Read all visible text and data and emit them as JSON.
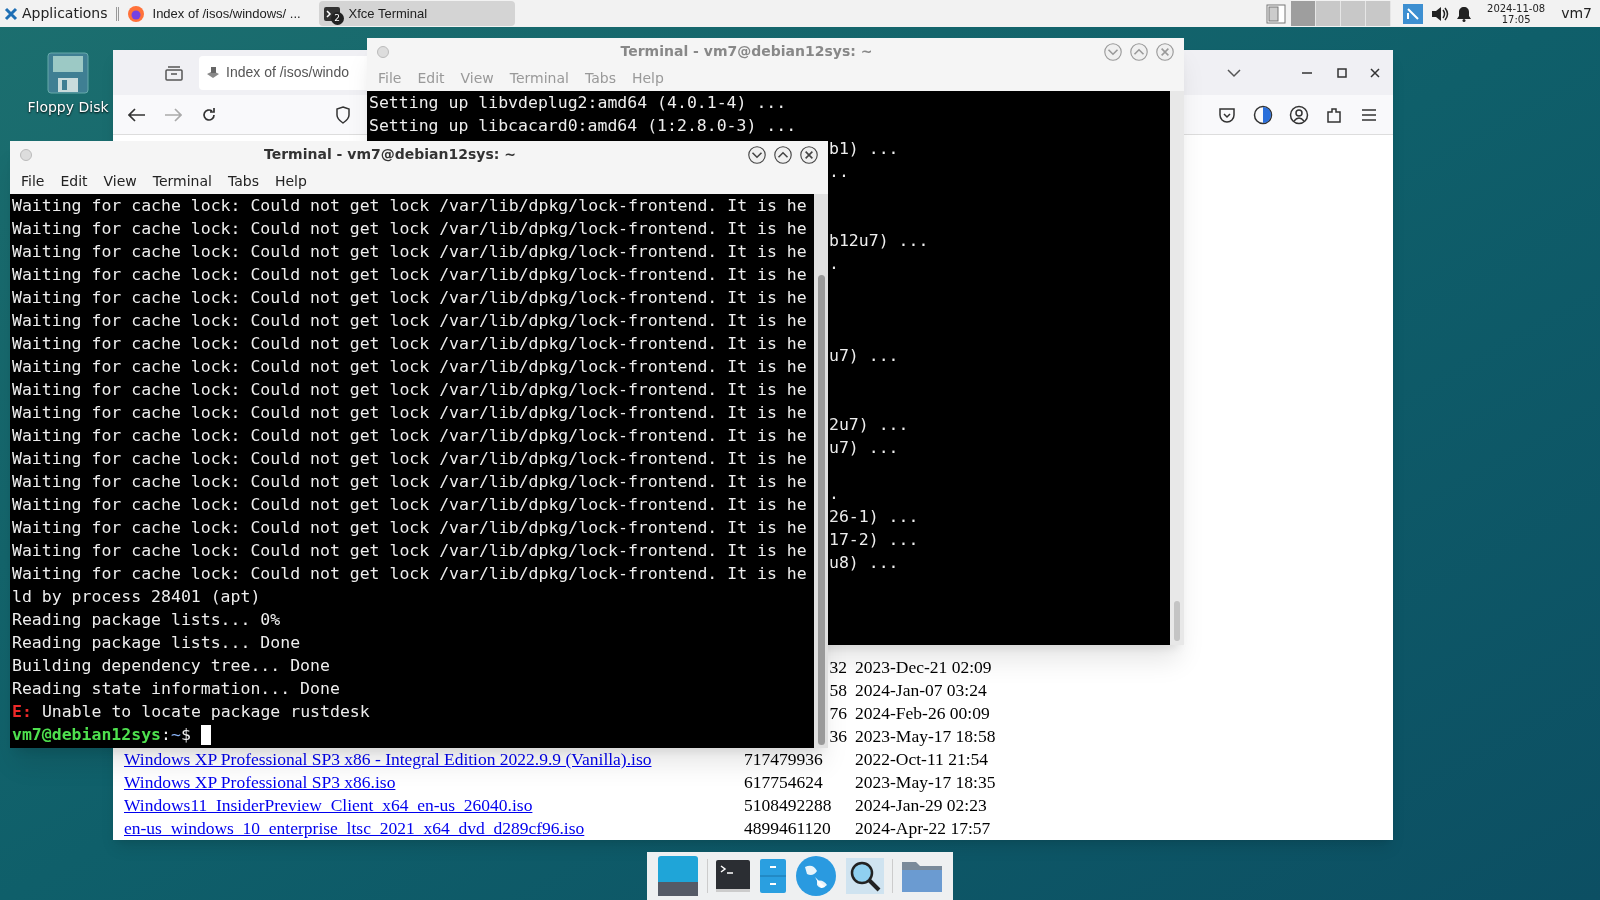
{
  "top_panel": {
    "menu_label": "Applications",
    "tasks": [
      {
        "kind": "browser",
        "label": "Index of /isos/windows/ ...",
        "selected": false
      },
      {
        "kind": "terminal",
        "label": "Xfce Terminal",
        "badge": "2",
        "selected": true
      }
    ],
    "workspaces": [
      {
        "selected": true
      },
      {
        "selected": false
      },
      {
        "selected": false
      },
      {
        "selected": false
      }
    ],
    "clock_date": "2024-11-08",
    "clock_time": "17:05",
    "user": "vm7"
  },
  "desktop_icons": [
    {
      "label": "Floppy Disk"
    }
  ],
  "browser": {
    "tab_title": "Index of /isos/windo",
    "rows": [
      {
        "kind": "partial",
        "size": "32",
        "date": "2023-Dec-21 02:09"
      },
      {
        "kind": "partial",
        "size": "58",
        "date": "2024-Jan-07 03:24"
      },
      {
        "kind": "partial",
        "size": "76",
        "date": "2024-Feb-26 00:09"
      },
      {
        "kind": "partial",
        "size": "36",
        "date": "2023-May-17 18:58"
      },
      {
        "kind": "full",
        "name": "Windows XP Professional SP3 x86 - Integral Edition 2022.9.9 (Vanilla).iso",
        "size": "717479936",
        "date": "2022-Oct-11 21:54"
      },
      {
        "kind": "full",
        "name": "Windows XP Professional SP3 x86.iso",
        "size": "617754624",
        "date": "2023-May-17 18:35"
      },
      {
        "kind": "full",
        "name": "Windows11_InsiderPreview_Client_x64_en-us_26040.iso",
        "size": "5108492288",
        "date": "2024-Jan-29 02:23"
      },
      {
        "kind": "full",
        "name": "en-us_windows_10_enterprise_ltsc_2021_x64_dvd_d289cf96.iso",
        "size": "4899461120",
        "date": "2024-Apr-22 17:57"
      }
    ]
  },
  "back_terminal": {
    "title": "Terminal - vm7@debian12sys: ~",
    "menu": [
      "File",
      "Edit",
      "View",
      "Terminal",
      "Tabs",
      "Help"
    ],
    "lines": [
      {
        "kind": "full",
        "text": "Setting up libvdeplug2:amd64 (4.0.1-4) ..."
      },
      {
        "kind": "full",
        "text": "Setting up libcacard0:amd64 (1:2.8.0-3) ..."
      },
      {
        "kind": "fragment",
        "text": "b1) ..."
      },
      {
        "kind": "fragment",
        "text": ".."
      },
      {
        "kind": "blank"
      },
      {
        "kind": "blank"
      },
      {
        "kind": "fragment",
        "text": "b12u7) ..."
      },
      {
        "kind": "fragment",
        "text": "."
      },
      {
        "kind": "blank"
      },
      {
        "kind": "blank"
      },
      {
        "kind": "blank"
      },
      {
        "kind": "fragment",
        "text": "u7) ..."
      },
      {
        "kind": "blank"
      },
      {
        "kind": "blank"
      },
      {
        "kind": "fragment",
        "text": "2u7) ..."
      },
      {
        "kind": "fragment",
        "text": "u7) ..."
      },
      {
        "kind": "blank"
      },
      {
        "kind": "fragment",
        "text": "."
      },
      {
        "kind": "fragment",
        "text": "26-1) ..."
      },
      {
        "kind": "fragment",
        "text": "17-2) ..."
      },
      {
        "kind": "fragment",
        "text": "u8) ..."
      }
    ]
  },
  "front_terminal": {
    "title": "Terminal - vm7@debian12sys: ~",
    "menu": [
      "File",
      "Edit",
      "View",
      "Terminal",
      "Tabs",
      "Help"
    ],
    "lines": [
      {
        "kind": "plain",
        "text": "Waiting for cache lock: Could not get lock /var/lib/dpkg/lock-frontend. It is he"
      },
      {
        "kind": "plain",
        "text": "Waiting for cache lock: Could not get lock /var/lib/dpkg/lock-frontend. It is he"
      },
      {
        "kind": "plain",
        "text": "Waiting for cache lock: Could not get lock /var/lib/dpkg/lock-frontend. It is he"
      },
      {
        "kind": "plain",
        "text": "Waiting for cache lock: Could not get lock /var/lib/dpkg/lock-frontend. It is he"
      },
      {
        "kind": "plain",
        "text": "Waiting for cache lock: Could not get lock /var/lib/dpkg/lock-frontend. It is he"
      },
      {
        "kind": "plain",
        "text": "Waiting for cache lock: Could not get lock /var/lib/dpkg/lock-frontend. It is he"
      },
      {
        "kind": "plain",
        "text": "Waiting for cache lock: Could not get lock /var/lib/dpkg/lock-frontend. It is he"
      },
      {
        "kind": "plain",
        "text": "Waiting for cache lock: Could not get lock /var/lib/dpkg/lock-frontend. It is he"
      },
      {
        "kind": "plain",
        "text": "Waiting for cache lock: Could not get lock /var/lib/dpkg/lock-frontend. It is he"
      },
      {
        "kind": "plain",
        "text": "Waiting for cache lock: Could not get lock /var/lib/dpkg/lock-frontend. It is he"
      },
      {
        "kind": "plain",
        "text": "Waiting for cache lock: Could not get lock /var/lib/dpkg/lock-frontend. It is he"
      },
      {
        "kind": "plain",
        "text": "Waiting for cache lock: Could not get lock /var/lib/dpkg/lock-frontend. It is he"
      },
      {
        "kind": "plain",
        "text": "Waiting for cache lock: Could not get lock /var/lib/dpkg/lock-frontend. It is he"
      },
      {
        "kind": "plain",
        "text": "Waiting for cache lock: Could not get lock /var/lib/dpkg/lock-frontend. It is he"
      },
      {
        "kind": "plain",
        "text": "Waiting for cache lock: Could not get lock /var/lib/dpkg/lock-frontend. It is he"
      },
      {
        "kind": "plain",
        "text": "Waiting for cache lock: Could not get lock /var/lib/dpkg/lock-frontend. It is he"
      },
      {
        "kind": "plain",
        "text": "Waiting for cache lock: Could not get lock /var/lib/dpkg/lock-frontend. It is he"
      },
      {
        "kind": "plain",
        "text": "ld by process 28401 (apt)"
      },
      {
        "kind": "plain",
        "text": "Reading package lists... 0%"
      },
      {
        "kind": "plain",
        "text": "Reading package lists... Done"
      },
      {
        "kind": "plain",
        "text": "Building dependency tree... Done"
      },
      {
        "kind": "plain",
        "text": "Reading state information... Done"
      },
      {
        "kind": "error",
        "label": "E:",
        "text": "Unable to locate package rustdesk"
      },
      {
        "kind": "prompt",
        "user_host": "vm7@debian12sys",
        "separator": ":",
        "path": "~",
        "symbol": "$"
      }
    ]
  }
}
